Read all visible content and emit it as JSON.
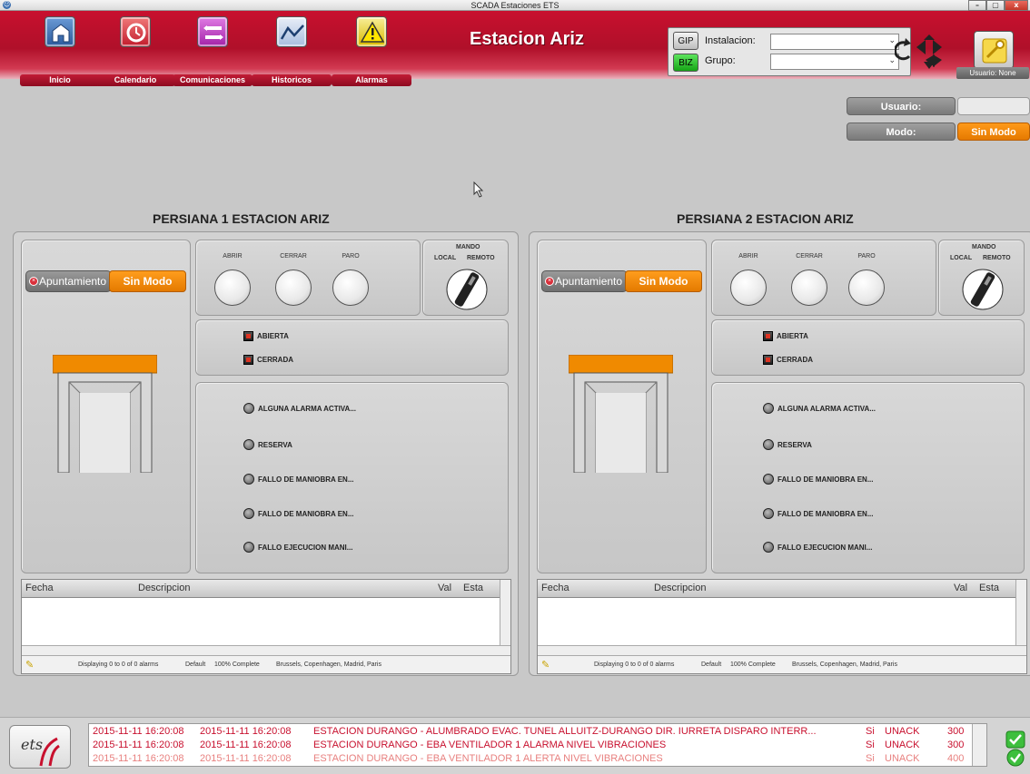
{
  "window": {
    "title": "SCADA Estaciones ETS",
    "min": "–",
    "max": "▢",
    "close": "x"
  },
  "nav": [
    {
      "label": "Inicio",
      "icon": "home-icon",
      "color": "#3a6fb0"
    },
    {
      "label": "Calendario",
      "icon": "calendar-icon",
      "color": "#d9303b"
    },
    {
      "label": "Comunicaciones",
      "icon": "communications-icon",
      "color": "#c23ac7"
    },
    {
      "label": "Historicos",
      "icon": "history-chart-icon",
      "color": "#3a6fb0"
    },
    {
      "label": "Alarmas",
      "icon": "alarm-warning-icon",
      "color": "#f2c900"
    }
  ],
  "station_title": "Estacion Ariz",
  "selector": {
    "gip": "GIP",
    "biz": "BIZ",
    "instalacion_label": "Instalacion:",
    "instalacion_value": "",
    "grupo_label": "Grupo:",
    "grupo_value": ""
  },
  "user_tag": "Usuario: None",
  "user_info": {
    "usuario_label": "Usuario:",
    "usuario_value": "",
    "modo_label": "Modo:",
    "modo_value": "Sin Modo"
  },
  "persianas": [
    {
      "title": "PERSIANA 1 ESTACION ARIZ",
      "apuntamiento": "Apuntamiento",
      "modo": "Sin Modo",
      "commands": [
        "ABRIR",
        "CERRAR",
        "PARO"
      ],
      "mando": "MANDO",
      "local": "LOCAL",
      "remoto": "REMOTO",
      "states": [
        "ABIERTA",
        "CERRADA"
      ],
      "alarms": [
        "ALGUNA ALARMA ACTIVA...",
        "RESERVA",
        "FALLO DE MANIOBRA EN...",
        "FALLO DE MANIOBRA EN...",
        "FALLO EJECUCION MANI..."
      ]
    },
    {
      "title": "PERSIANA 2 ESTACION ARIZ",
      "apuntamiento": "Apuntamiento",
      "modo": "Sin Modo",
      "commands": [
        "ABRIR",
        "CERRAR",
        "PARO"
      ],
      "mando": "MANDO",
      "local": "LOCAL",
      "remoto": "REMOTO",
      "states": [
        "ABIERTA",
        "CERRADA"
      ],
      "alarms": [
        "ALGUNA ALARMA ACTIVA...",
        "RESERVA",
        "FALLO DE MANIOBRA EN...",
        "FALLO DE MANIOBRA EN...",
        "FALLO EJECUCION MANI..."
      ]
    }
  ],
  "alarm_grid": {
    "columns": [
      "Fecha",
      "Descripcion",
      "Val",
      "Esta"
    ],
    "status": "Displaying 0 to 0 of 0 alarms",
    "filter": "Default",
    "progress": "100% Complete",
    "timezone": "Brussels, Copenhagen, Madrid, Paris"
  },
  "bottom_alarms": [
    {
      "t1": "2015-11-11 16:20:08",
      "t2": "2015-11-11 16:20:08",
      "desc": "ESTACION DURANGO - ALUMBRADO EVAC. TUNEL ALLUITZ-DURANGO DIR. IURRETA DISPARO INTERR...",
      "val": "Si",
      "state": "UNACK",
      "prio": "300"
    },
    {
      "t1": "2015-11-11 16:20:08",
      "t2": "2015-11-11 16:20:08",
      "desc": "ESTACION DURANGO - EBA VENTILADOR 1 ALARMA NIVEL VIBRACIONES",
      "val": "Si",
      "state": "UNACK",
      "prio": "300"
    },
    {
      "t1": "2015-11-11 16:20:08",
      "t2": "2015-11-11 16:20:08",
      "desc": "ESTACION DURANGO - EBA VENTILADOR 1 ALERTA NIVEL VIBRACIONES",
      "val": "Si",
      "state": "UNACK",
      "prio": "400"
    }
  ],
  "logo_text": "ets"
}
